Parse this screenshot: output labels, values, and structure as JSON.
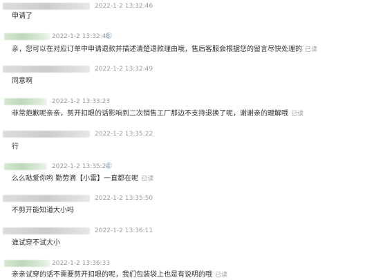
{
  "messages": [
    {
      "role": "customer",
      "timestamp": "2022-1-2 13:32:46",
      "text": "申请了",
      "read": ""
    },
    {
      "role": "service",
      "timestamp": "2022-1-2 13:32:48",
      "text": "亲，您可以在对应订单中申请退款并描述清楚退款理由哦，售后客服会根据您的留言尽快处理的",
      "read": "已读"
    },
    {
      "role": "customer",
      "timestamp": "2022-1-2 13:32:49",
      "text": "同意啊",
      "read": ""
    },
    {
      "role": "service",
      "timestamp": "2022-1-2 13:33:23",
      "text": "非常抱歉呢亲亲，剪开扣眼的话影响到二次销售工厂那边不支持退换了呢，谢谢亲的理解哦",
      "read": "已读"
    },
    {
      "role": "customer",
      "timestamp": "2022-1-2 13:35:22",
      "text": "行",
      "read": ""
    },
    {
      "role": "service",
      "timestamp": "2022-1-2 13:35:24",
      "text": "么么哒爱你哟  勤劳滴【小雷】一直都在呢",
      "read": "已读"
    },
    {
      "role": "customer",
      "timestamp": "2022-1-2 13:35:50",
      "text": "不剪开能知道大小吗",
      "read": ""
    },
    {
      "role": "customer",
      "timestamp": "2022-1-2 13:36:11",
      "text": "谁试穿不试大小",
      "read": ""
    },
    {
      "role": "service",
      "timestamp": "2022-1-2 13:36:33",
      "text": "亲亲试穿的话不需要剪开扣眼的呢，我们包装袋上也是有说明的哦",
      "read": "已读"
    }
  ]
}
